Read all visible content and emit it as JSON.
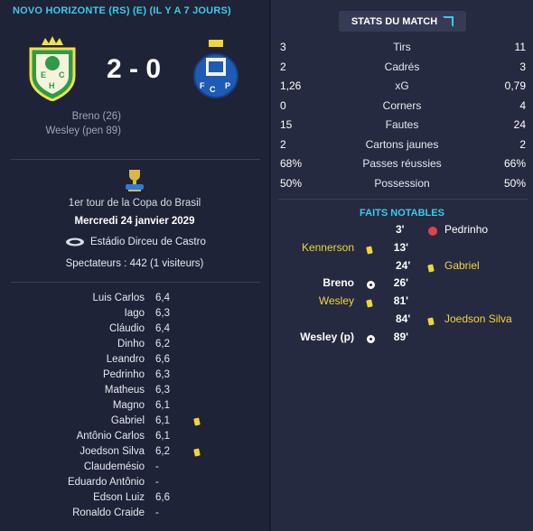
{
  "header": {
    "title": "NOVO HORIZONTE (RS) (E) (IL Y A 7 JOURS)"
  },
  "score": {
    "display": "2 - 0"
  },
  "scorers": [
    "Breno (26)",
    "Wesley (pen 89)"
  ],
  "match_info": {
    "round": "1er tour de la Copa do Brasil",
    "date": "Mercredi 24 janvier 2029",
    "stadium": "Estádio Dirceu de Castro",
    "attendance": "Spectateurs : 442 (1 visiteurs)"
  },
  "ratings": [
    {
      "name": "Luis Carlos",
      "rating": "6,4",
      "yellow": false
    },
    {
      "name": "Iago",
      "rating": "6,3",
      "yellow": false
    },
    {
      "name": "Cláudio",
      "rating": "6,4",
      "yellow": false
    },
    {
      "name": "Dinho",
      "rating": "6,2",
      "yellow": false
    },
    {
      "name": "Leandro",
      "rating": "6,6",
      "yellow": false
    },
    {
      "name": "Pedrinho",
      "rating": "6,3",
      "yellow": false
    },
    {
      "name": "Matheus",
      "rating": "6,3",
      "yellow": false
    },
    {
      "name": "Magno",
      "rating": "6,1",
      "yellow": false
    },
    {
      "name": "Gabriel",
      "rating": "6,1",
      "yellow": true
    },
    {
      "name": "Antônio Carlos",
      "rating": "6,1",
      "yellow": false
    },
    {
      "name": "Joedson Silva",
      "rating": "6,2",
      "yellow": true
    },
    {
      "name": "Claudemésio",
      "rating": "-",
      "yellow": false
    },
    {
      "name": "Eduardo Antônio",
      "rating": "-",
      "yellow": false
    },
    {
      "name": "Edson Luiz",
      "rating": "6,6",
      "yellow": false
    },
    {
      "name": "Ronaldo Craide",
      "rating": "-",
      "yellow": false
    }
  ],
  "stats_button": {
    "label": "STATS DU MATCH"
  },
  "stats": [
    {
      "home": "3",
      "label": "Tirs",
      "away": "11"
    },
    {
      "home": "2",
      "label": "Cadrés",
      "away": "3"
    },
    {
      "home": "1,26",
      "label": "xG",
      "away": "0,79"
    },
    {
      "home": "0",
      "label": "Corners",
      "away": "4"
    },
    {
      "home": "15",
      "label": "Fautes",
      "away": "24"
    },
    {
      "home": "2",
      "label": "Cartons jaunes",
      "away": "2"
    },
    {
      "home": "68%",
      "label": "Passes réussies",
      "away": "66%"
    },
    {
      "home": "50%",
      "label": "Possession",
      "away": "50%"
    }
  ],
  "events_title": "FAITS NOTABLES",
  "events": [
    {
      "side": "away",
      "player": "Pedrinho",
      "minute": "3'",
      "icon": "substitution-icon"
    },
    {
      "side": "home",
      "player": "Kennerson",
      "minute": "13'",
      "icon": "yellow-card-icon"
    },
    {
      "side": "away",
      "player": "Gabriel",
      "minute": "24'",
      "icon": "yellow-card-icon"
    },
    {
      "side": "home",
      "player": "Breno",
      "minute": "26'",
      "icon": "goal-ball-icon"
    },
    {
      "side": "home",
      "player": "Wesley",
      "minute": "81'",
      "icon": "yellow-card-icon"
    },
    {
      "side": "away",
      "player": "Joedson Silva",
      "minute": "84'",
      "icon": "yellow-card-icon"
    },
    {
      "side": "home",
      "player": "Wesley (p)",
      "minute": "89'",
      "icon": "goal-ball-icon"
    }
  ],
  "colors": {
    "accent": "#3fc8ec",
    "yellow": "#f2d43a",
    "background": "#1f2337",
    "panel": "#262a40"
  }
}
